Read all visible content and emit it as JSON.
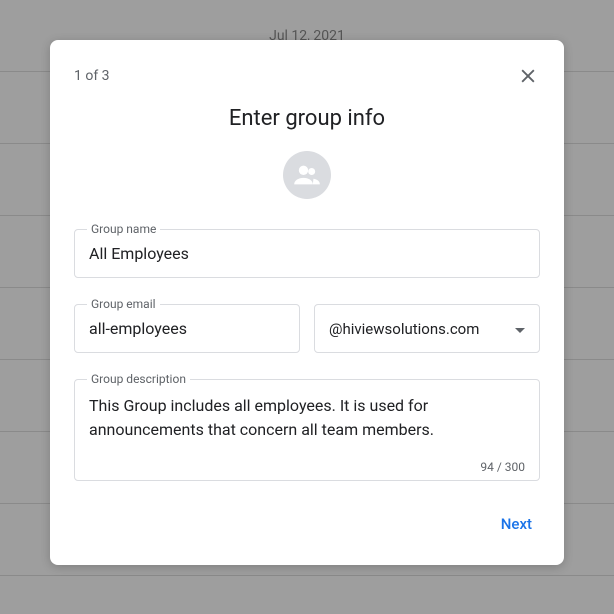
{
  "background": {
    "date": "Jul 12, 2021"
  },
  "modal": {
    "step": "1 of 3",
    "title": "Enter group info",
    "groupName": {
      "label": "Group name",
      "value": "All Employees"
    },
    "groupEmail": {
      "label": "Group email",
      "value": "all-employees",
      "domain": "@hiviewsolutions.com"
    },
    "groupDescription": {
      "label": "Group description",
      "value": "This Group includes all employees. It is used for announcements that concern all team members.",
      "counter": "94 / 300"
    },
    "nextButton": "Next"
  }
}
